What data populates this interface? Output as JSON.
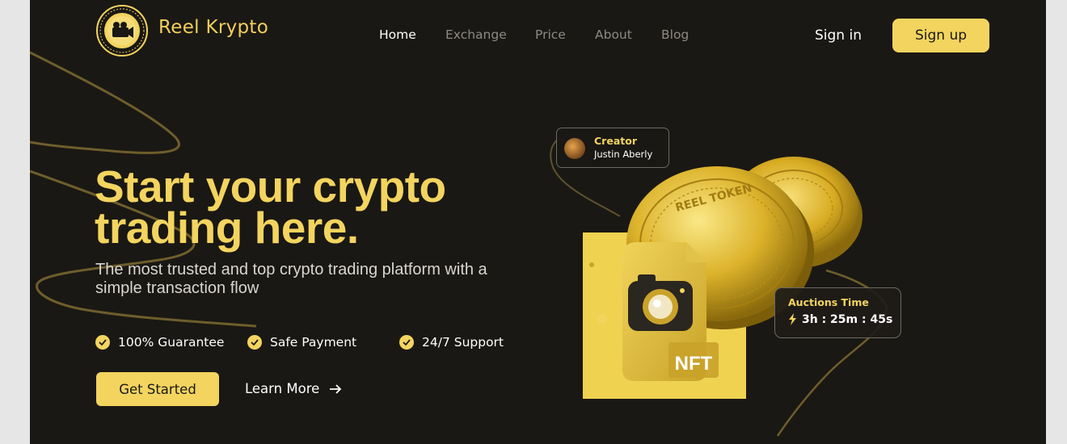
{
  "brand": {
    "name": "Reel Krypto",
    "logo_icon": "film-camera-coin-logo"
  },
  "nav": {
    "items": [
      {
        "label": "Home",
        "active": true
      },
      {
        "label": "Exchange",
        "active": false
      },
      {
        "label": "Price",
        "active": false
      },
      {
        "label": "About",
        "active": false
      },
      {
        "label": "Blog",
        "active": false
      }
    ],
    "sign_in": "Sign in",
    "sign_up": "Sign up"
  },
  "hero": {
    "title_line1": "Start your crypto",
    "title_line2": "trading here.",
    "subtitle": "The most trusted and top crypto trading platform with a simple transaction flow",
    "features": [
      "100% Guarantee",
      "Safe Payment",
      "24/7 Support"
    ],
    "primary_cta": "Get Started",
    "secondary_cta": "Learn More"
  },
  "illustration": {
    "creator_label": "Creator",
    "creator_name": "Justin Aberly",
    "auction_label": "Auctions Time",
    "auction_time": "3h : 25m : 45s",
    "nft_label": "NFT",
    "coin_text": "REEL TOKEN"
  },
  "colors": {
    "background": "#1a1814",
    "accent": "#f3d45f",
    "text_primary": "#ffffff",
    "text_muted": "#8d8a83"
  }
}
